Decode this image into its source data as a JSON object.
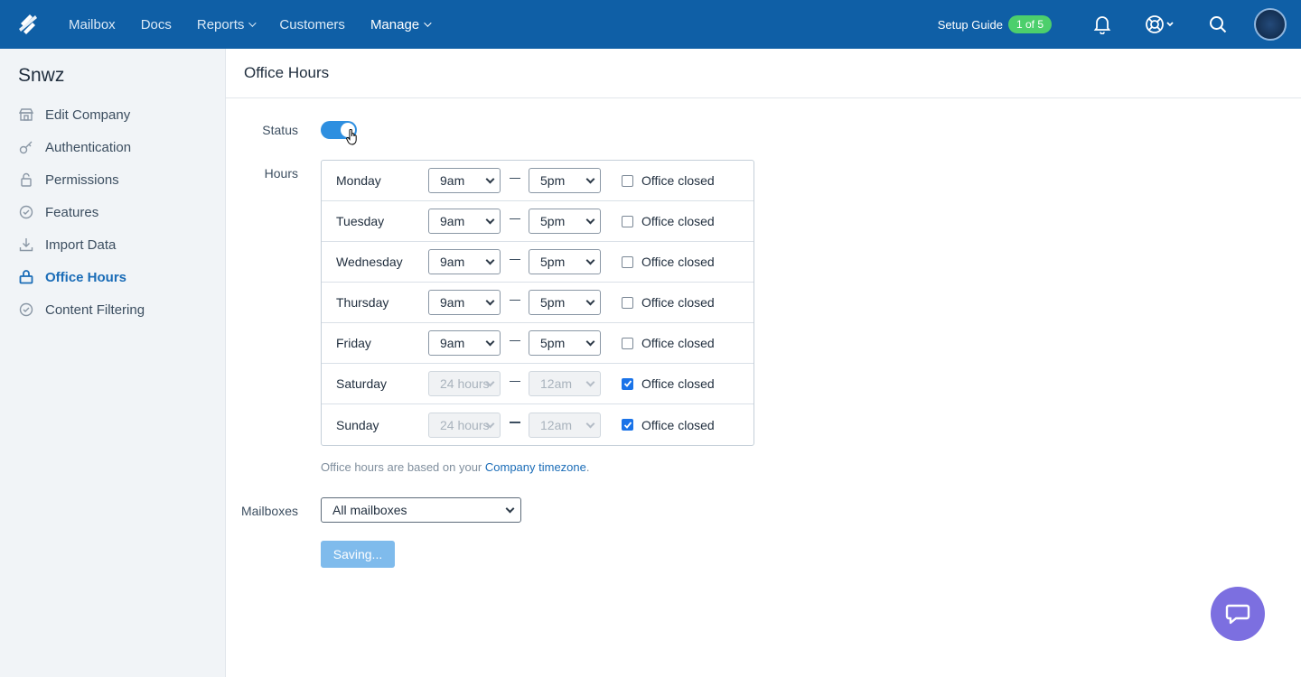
{
  "topnav": {
    "items": [
      {
        "label": "Mailbox"
      },
      {
        "label": "Docs"
      },
      {
        "label": "Reports"
      },
      {
        "label": "Customers"
      },
      {
        "label": "Manage"
      }
    ],
    "setup_guide": "Setup Guide",
    "setup_badge": "1 of 5"
  },
  "sidebar": {
    "company": "Snwz",
    "items": [
      {
        "label": "Edit Company",
        "icon": "store-icon"
      },
      {
        "label": "Authentication",
        "icon": "key-icon"
      },
      {
        "label": "Permissions",
        "icon": "lock-icon"
      },
      {
        "label": "Features",
        "icon": "features-icon"
      },
      {
        "label": "Import Data",
        "icon": "download-icon"
      },
      {
        "label": "Office Hours",
        "icon": "briefcase-icon"
      },
      {
        "label": "Content Filtering",
        "icon": "filter-icon"
      }
    ]
  },
  "main": {
    "title": "Office Hours",
    "status_label": "Status",
    "hours_label": "Hours",
    "closed_label": "Office closed",
    "days": [
      {
        "day": "Monday",
        "open": "9am",
        "close": "5pm"
      },
      {
        "day": "Tuesday",
        "open": "9am",
        "close": "5pm"
      },
      {
        "day": "Wednesday",
        "open": "9am",
        "close": "5pm"
      },
      {
        "day": "Thursday",
        "open": "9am",
        "close": "5pm"
      },
      {
        "day": "Friday",
        "open": "9am",
        "close": "5pm"
      },
      {
        "day": "Saturday",
        "open": "24 hours",
        "close": "12am"
      },
      {
        "day": "Sunday",
        "open": "24 hours",
        "close": "12am"
      }
    ],
    "note_prefix": "Office hours are based on your ",
    "note_link": "Company timezone",
    "note_suffix": ".",
    "mailboxes_label": "Mailboxes",
    "mailboxes_value": "All mailboxes",
    "save_label": "Saving..."
  },
  "colors": {
    "topbar": "#0f5fa6",
    "accent": "#1a6cb7",
    "toggle": "#2e8fe0",
    "badge": "#4ccf6c",
    "beacon": "#7c6fe0"
  }
}
